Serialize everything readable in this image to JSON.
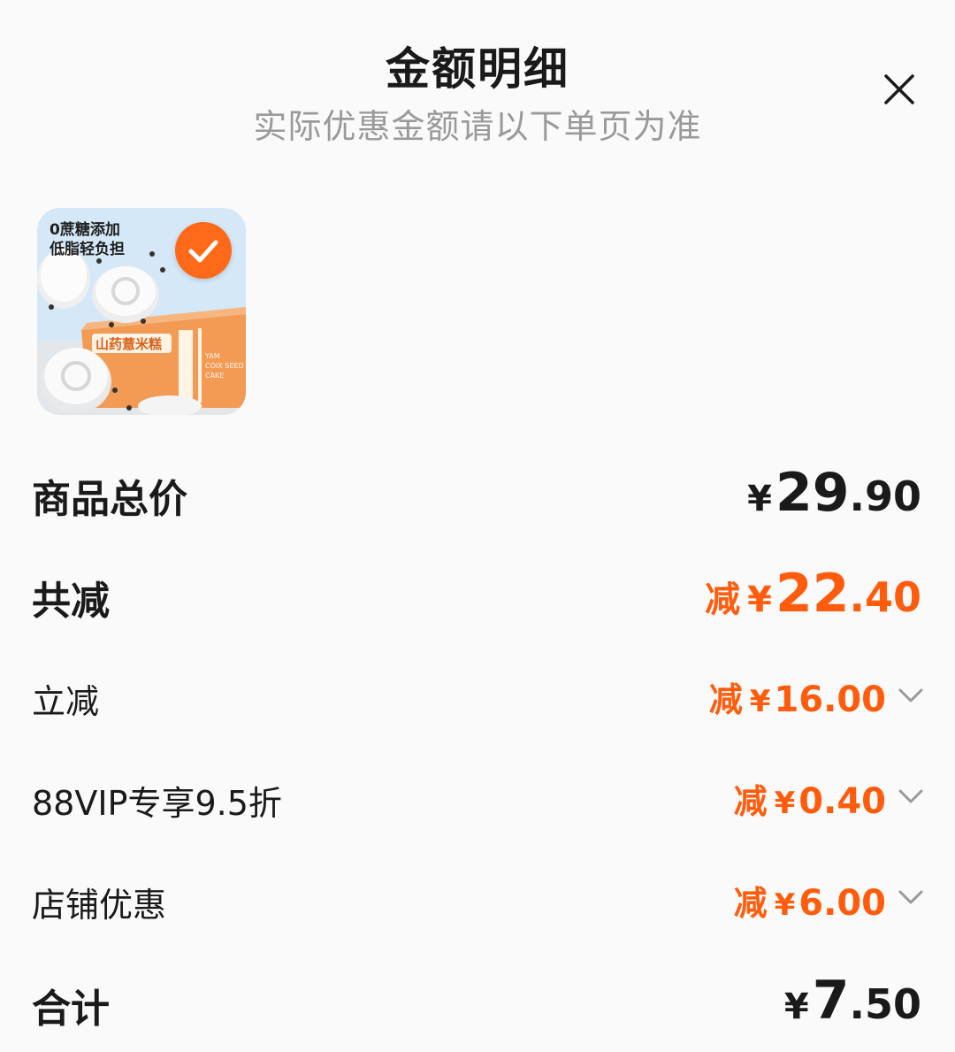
{
  "header": {
    "title": "金额明细",
    "subtitle": "实际优惠金额请以下单页为准"
  },
  "product": {
    "tagline_line1": "0蔗糖添加",
    "tagline_line2": "低脂轻负担",
    "box_label": "山药薏米糕",
    "box_english_1": "YAM",
    "box_english_2": "COIX SEED",
    "box_english_3": "CAKE",
    "selected": true
  },
  "summary": {
    "subtotal": {
      "label": "商品总价",
      "yen": "¥",
      "int": "29",
      "dec": ".90"
    },
    "total_discount": {
      "label": "共减",
      "prefix": "减",
      "yen": "¥",
      "int": "22",
      "dec": ".40"
    },
    "total": {
      "label": "合计",
      "yen": "¥",
      "int": "7",
      "dec": ".50"
    }
  },
  "discounts": [
    {
      "label": "立减",
      "prefix": "减",
      "yen": "¥",
      "amount": "16.00"
    },
    {
      "label": "88VIP专享9.5折",
      "prefix": "减",
      "yen": "¥",
      "amount": "0.40"
    },
    {
      "label": "店铺优惠",
      "prefix": "减",
      "yen": "¥",
      "amount": "6.00"
    }
  ],
  "colors": {
    "accent": "#ff5d0d",
    "text": "#1a1a1a",
    "muted": "#9a9a9a"
  },
  "icons": {
    "close": "close-icon",
    "check": "checkmark-icon",
    "expand": "chevron-down-icon"
  }
}
